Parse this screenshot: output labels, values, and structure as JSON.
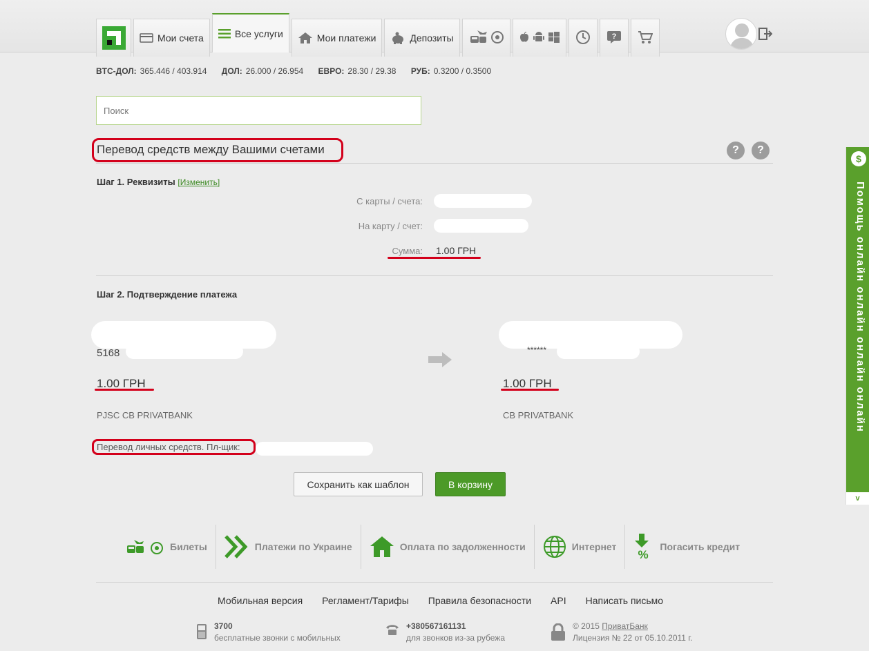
{
  "nav": {
    "tabs": [
      {
        "label": "Мои счета"
      },
      {
        "label": "Все услуги"
      },
      {
        "label": "Мои платежи"
      },
      {
        "label": "Депозиты"
      }
    ]
  },
  "rates": [
    {
      "name": "BTC-ДОЛ:",
      "value": "365.446 / 403.914"
    },
    {
      "name": "ДОЛ:",
      "value": "26.000 / 26.954"
    },
    {
      "name": "ЕВРО:",
      "value": "28.30 / 29.38"
    },
    {
      "name": "РУБ:",
      "value": "0.3200 / 0.3500"
    }
  ],
  "search": {
    "placeholder": "Поиск"
  },
  "page": {
    "title": "Перевод средств между Вашими счетами"
  },
  "step1": {
    "title": "Шаг 1. Реквизиты",
    "edit_link": "[Изменить]",
    "from_label": "С карты / счета:",
    "to_label": "На карту / счет:",
    "amount_label": "Сумма:",
    "amount_value": "1.00 ГРН"
  },
  "step2": {
    "title": "Шаг 2. Подтверждение платежа",
    "from": {
      "card": "5168",
      "amount": "1.00 ГРН",
      "bank": "PJSC CB PRIVATBANK"
    },
    "to": {
      "card": "******",
      "amount": "1.00 ГРН",
      "bank": "CB PRIVATBANK"
    },
    "purpose": "Перевод личных средств. Пл-щик:"
  },
  "buttons": {
    "save_template": "Сохранить как шаблон",
    "to_cart": "В корзину"
  },
  "services": [
    {
      "label": "Билеты",
      "icon": "tickets-icon"
    },
    {
      "label": "Платежи по Украине",
      "icon": "chevrons-icon"
    },
    {
      "label": "Оплата по задолженности",
      "icon": "house-icon"
    },
    {
      "label": "Интернет",
      "icon": "globe-icon"
    },
    {
      "label": "Погасить кредит",
      "icon": "percent-icon"
    }
  ],
  "footer": {
    "links": [
      "Мобильная версия",
      "Регламент/Тарифы",
      "Правила безопасности",
      "API",
      "Написать письмо"
    ],
    "mobile": {
      "number": "3700",
      "note": "бесплатные звонки с мобильных"
    },
    "abroad": {
      "number": "+380567161131",
      "note": "для звонков из-за рубежа"
    },
    "copyright": {
      "prefix": "© 2015 ",
      "brand": "ПриватБанк",
      "license": "Лицензия № 22 от 05.10.2011 г."
    }
  },
  "side_tab": {
    "text": "Помощь онлайн онлайн онлайн онлайн",
    "icon_char": "$",
    "bottom": "v"
  },
  "colors": {
    "accent": "#5aa02c",
    "annotation": "#d3001b"
  }
}
